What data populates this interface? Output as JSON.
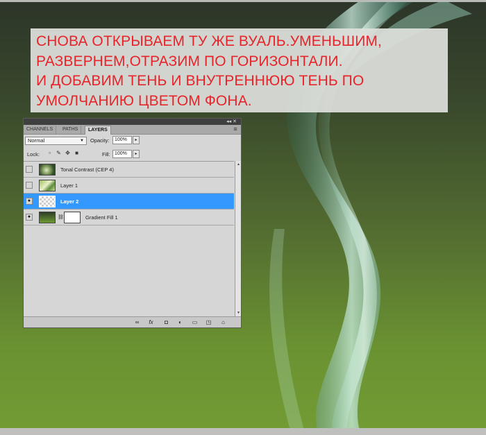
{
  "caption": {
    "lines": [
      "СНОВА ОТКРЫВАЕМ ТУ ЖЕ ВУАЛЬ.УМЕНЬШИМ,",
      "РАЗВЕРНЕМ,ОТРАЗИМ ПО ГОРИЗОНТАЛИ.",
      "И ДОБАВИМ ТЕНЬ И ВНУТРЕННЮЮ ТЕНЬ ПО",
      "УМОЛЧАНИЮ ЦВЕТОМ ФОНА."
    ],
    "color": "#e8242a"
  },
  "panel": {
    "tabs": [
      "CHANNELS",
      "PATHS",
      "LAYERS"
    ],
    "active_tab": "LAYERS",
    "blend_mode": "Normal",
    "opacity_label": "Opacity:",
    "opacity_value": "100%",
    "lock_label": "Lock:",
    "fill_label": "Fill:",
    "fill_value": "100%",
    "layers": [
      {
        "name": "Tonal Contrast (CEP 4)",
        "visible": false,
        "selected": false,
        "thumb": "photo-thumb"
      },
      {
        "name": "Layer 1",
        "visible": false,
        "selected": false,
        "thumb": "veil-thumb"
      },
      {
        "name": "Layer 2",
        "visible": true,
        "selected": true,
        "thumb": "transparent-thumb"
      },
      {
        "name": "Gradient Fill 1",
        "visible": true,
        "selected": false,
        "thumb": "gradient-thumb"
      }
    ],
    "selection_color": "#3399ff"
  },
  "icons": {
    "eye": "eye-icon",
    "link": "link-icon",
    "fx": "fx-icon",
    "mask": "mask-icon",
    "adjustment": "adjustment-icon",
    "group": "folder-icon",
    "new_layer": "new-layer-icon",
    "delete": "trash-icon"
  }
}
